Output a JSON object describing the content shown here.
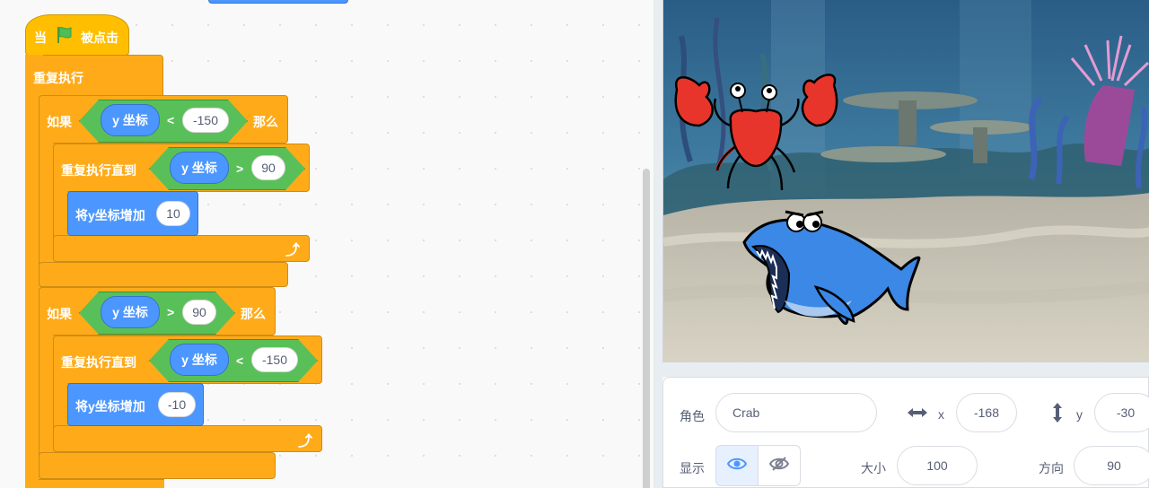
{
  "code": {
    "hat": {
      "when": "当",
      "flag_icon": "green-flag-icon",
      "clicked": "被点击"
    },
    "forever": "重复执行",
    "if1": {
      "if_label": "如果",
      "reporter": "y 坐标",
      "operator": "<",
      "value": "-150",
      "then_label": "那么"
    },
    "repeat_until1": {
      "label": "重复执行直到",
      "reporter": "y 坐标",
      "operator": ">",
      "value": "90"
    },
    "change1": {
      "label": "将y坐标增加",
      "value": "10"
    },
    "if2": {
      "if_label": "如果",
      "reporter": "y 坐标",
      "operator": ">",
      "value": "90",
      "then_label": "那么"
    },
    "repeat_until2": {
      "label": "重复执行直到",
      "reporter": "y 坐标",
      "operator": "<",
      "value": "-150"
    },
    "change2": {
      "label": "将y坐标增加",
      "value": "-10"
    },
    "loop_arrow_icon": "loop-arrow-icon"
  },
  "stage": {
    "backdrop": "underwater",
    "sprites": [
      "crab",
      "shark"
    ]
  },
  "sprite_info": {
    "sprite_label": "角色",
    "sprite_name": "Crab",
    "x_icon": "horizontal-arrows-icon",
    "x_label": "x",
    "x_value": "-168",
    "y_icon": "vertical-arrows-icon",
    "y_label": "y",
    "y_value": "-30",
    "show_label": "显示",
    "show_icon": "eye-icon",
    "hide_icon": "eye-slash-icon",
    "size_label": "大小",
    "size_value": "100",
    "direction_label": "方向",
    "direction_value": "90"
  },
  "colors": {
    "control": "#ffab19",
    "events": "#ffbf00",
    "motion": "#4c97ff",
    "operators": "#59c059"
  }
}
